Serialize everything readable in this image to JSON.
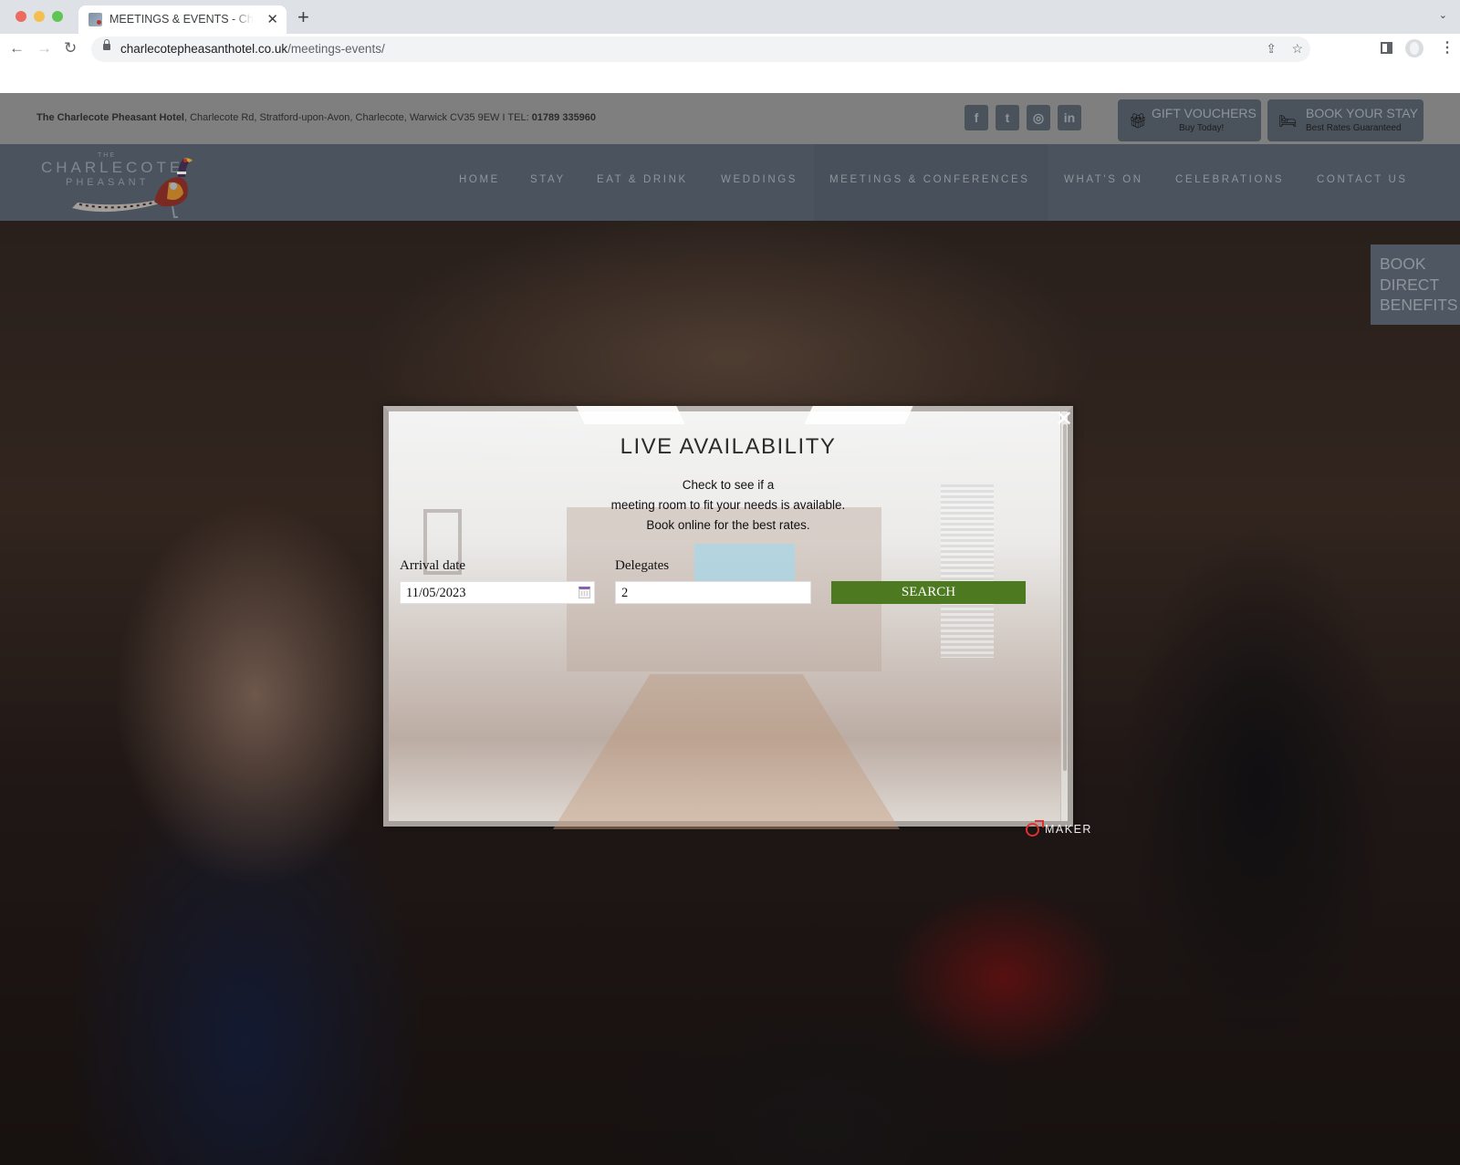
{
  "browser": {
    "tab_title": "MEETINGS & EVENTS - Charlecote Pheasant",
    "tab_close": "✕",
    "new_tab": "+",
    "tab_menu": "⌄",
    "url_domain": "charlecotepheasanthotel.co.uk",
    "url_path": "/meetings-events/",
    "icons": {
      "back": "←",
      "forward": "→",
      "reload": "↻",
      "share": "⇪",
      "star": "☆",
      "kebab": "⋮"
    }
  },
  "topbar": {
    "hotel_name": "The Charlecote Pheasant Hotel",
    "address": ", Charlecote Rd, Stratford-upon-Avon, Charlecote, Warwick CV35 9EW  I  TEL: ",
    "phone": "01789 335960",
    "social": [
      {
        "name": "facebook",
        "glyph": "f"
      },
      {
        "name": "twitter",
        "glyph": "t"
      },
      {
        "name": "instagram",
        "glyph": "◎"
      },
      {
        "name": "linkedin",
        "glyph": "in"
      }
    ],
    "gift": {
      "icon": "gift-icon",
      "glyph": "🎁︎",
      "title": "GIFT VOUCHERS",
      "sub": "Buy Today!"
    },
    "book": {
      "icon": "bed-icon",
      "glyph": "🛏︎",
      "title": "BOOK YOUR STAY",
      "sub": "Best Rates Guaranteed"
    }
  },
  "logo": {
    "the": "THE",
    "main": "CHARLECOTE",
    "sub": "PHEASANT"
  },
  "nav": {
    "items": [
      {
        "label": "HOME"
      },
      {
        "label": "STAY"
      },
      {
        "label": "EAT & DRINK"
      },
      {
        "label": "WEDDINGS"
      },
      {
        "label": "MEETINGS & CONFERENCES",
        "active": true
      },
      {
        "label": "WHAT'S ON"
      },
      {
        "label": "CELEBRATIONS"
      },
      {
        "label": "CONTACT US"
      }
    ]
  },
  "book_direct": {
    "lines": [
      "BOOK",
      "DIRECT",
      "BENEFITS"
    ]
  },
  "modal": {
    "title": "LIVE AVAILABILITY",
    "lines": [
      "Check to see if a",
      "meeting room to fit your needs is available.",
      "Book online for the best rates."
    ],
    "close": "✕",
    "arrival_label": "Arrival date",
    "arrival_value": "11/05/2023",
    "delegates_label": "Delegates",
    "delegates_value": "2",
    "search_label": "SEARCH",
    "accent": "#4d7a21"
  },
  "maker": {
    "label": "MAKER"
  }
}
